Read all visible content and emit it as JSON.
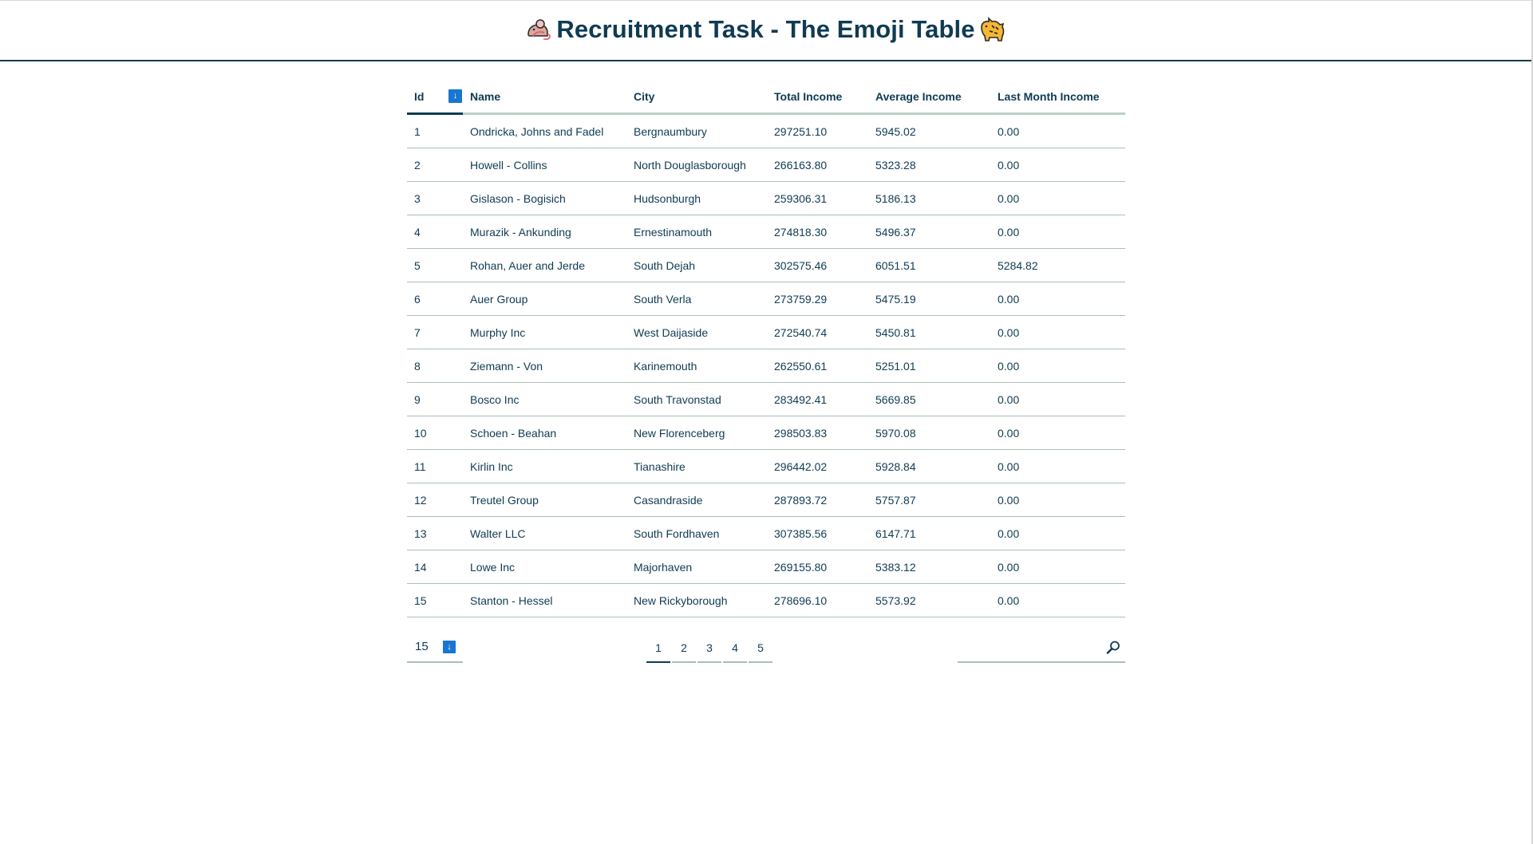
{
  "header": {
    "title": "Recruitment Task - The Emoji Table",
    "left_icon": "rat-emoji-icon",
    "right_icon": "tiger-emoji-icon"
  },
  "table": {
    "sort_icon": "sort-down-icon",
    "columns": [
      "Id",
      "Name",
      "City",
      "Total Income",
      "Average Income",
      "Last Month Income"
    ],
    "rows": [
      [
        "1",
        "Ondricka, Johns and Fadel",
        "Bergnaumbury",
        "297251.10",
        "5945.02",
        "0.00"
      ],
      [
        "2",
        "Howell - Collins",
        "North Douglasborough",
        "266163.80",
        "5323.28",
        "0.00"
      ],
      [
        "3",
        "Gislason - Bogisich",
        "Hudsonburgh",
        "259306.31",
        "5186.13",
        "0.00"
      ],
      [
        "4",
        "Murazik - Ankunding",
        "Ernestinamouth",
        "274818.30",
        "5496.37",
        "0.00"
      ],
      [
        "5",
        "Rohan, Auer and Jerde",
        "South Dejah",
        "302575.46",
        "6051.51",
        "5284.82"
      ],
      [
        "6",
        "Auer Group",
        "South Verla",
        "273759.29",
        "5475.19",
        "0.00"
      ],
      [
        "7",
        "Murphy Inc",
        "West Daijaside",
        "272540.74",
        "5450.81",
        "0.00"
      ],
      [
        "8",
        "Ziemann - Von",
        "Karinemouth",
        "262550.61",
        "5251.01",
        "0.00"
      ],
      [
        "9",
        "Bosco Inc",
        "South Travonstad",
        "283492.41",
        "5669.85",
        "0.00"
      ],
      [
        "10",
        "Schoen - Beahan",
        "New Florenceberg",
        "298503.83",
        "5970.08",
        "0.00"
      ],
      [
        "11",
        "Kirlin Inc",
        "Tianashire",
        "296442.02",
        "5928.84",
        "0.00"
      ],
      [
        "12",
        "Treutel Group",
        "Casandraside",
        "287893.72",
        "5757.87",
        "0.00"
      ],
      [
        "13",
        "Walter LLC",
        "South Fordhaven",
        "307385.56",
        "6147.71",
        "0.00"
      ],
      [
        "14",
        "Lowe Inc",
        "Majorhaven",
        "269155.80",
        "5383.12",
        "0.00"
      ],
      [
        "15",
        "Stanton - Hessel",
        "New Rickyborough",
        "278696.10",
        "5573.92",
        "0.00"
      ]
    ]
  },
  "footer": {
    "per_page_value": "15",
    "per_page_icon": "dropdown-down-icon",
    "pages": [
      "1",
      "2",
      "3",
      "4",
      "5"
    ],
    "active_page": "1",
    "search_value": "",
    "search_placeholder": "",
    "search_icon": "magnifier-icon"
  },
  "colors": {
    "primary_text": "#0f3b52",
    "accent_blue": "#1976d2",
    "divider": "#a9bfb5",
    "header_underline": "#b8d1c2"
  }
}
